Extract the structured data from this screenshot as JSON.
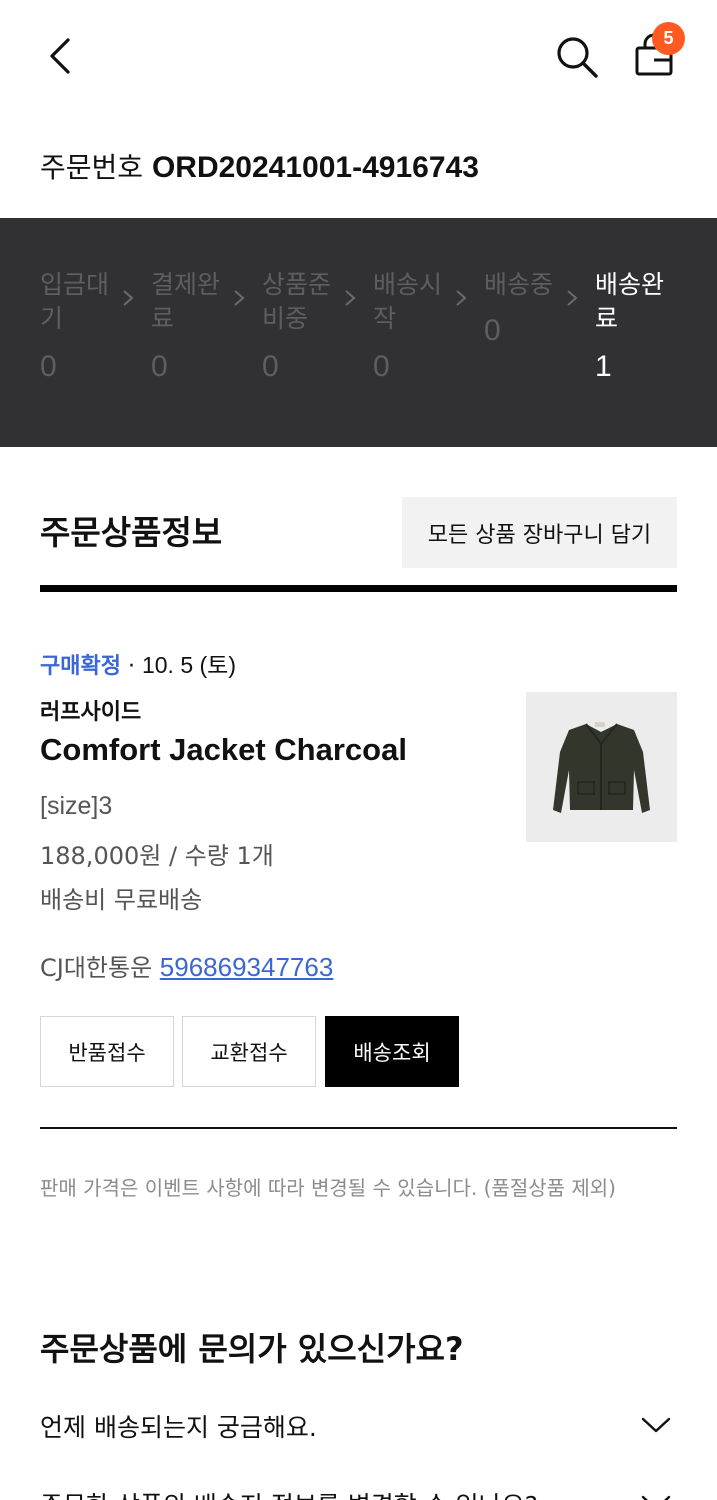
{
  "header": {
    "back_icon": "chevron-left-icon",
    "search_icon": "search-icon",
    "cart_icon": "shopping-bag-icon",
    "cart_count": "5",
    "badge_color": "#ff5a1f"
  },
  "order": {
    "label": "주문번호",
    "number": "ORD20241001-4916743"
  },
  "status_steps": [
    {
      "label": "입금대기",
      "count": "0",
      "active": false
    },
    {
      "label": "결제완료",
      "count": "0",
      "active": false
    },
    {
      "label": "상품준비중",
      "count": "0",
      "active": false
    },
    {
      "label": "배송시작",
      "count": "0",
      "active": false
    },
    {
      "label": "배송중",
      "count": "0",
      "active": false
    },
    {
      "label": "배송완료",
      "count": "1",
      "active": true
    }
  ],
  "section": {
    "title": "주문상품정보",
    "cart_all_label": "모든 상품 장바구니 담기"
  },
  "item": {
    "status": "구매확정",
    "separator": "·",
    "date": "10. 5 (토)",
    "brand": "러프사이드",
    "name": "Comfort Jacket Charcoal",
    "option": "[size]3",
    "price_qty": "188,000원 / 수량 1개",
    "shipping": "배송비 무료배송",
    "courier": "CJ대한통운",
    "tracking_no": "596869347763",
    "image": "charcoal-jacket-photo",
    "link_color": "#3b66d6"
  },
  "actions": {
    "return_label": "반품접수",
    "exchange_label": "교환접수",
    "track_label": "배송조회"
  },
  "notice": "판매 가격은 이벤트 사항에 따라 변경될 수 있습니다. (품절상품 제외)",
  "faq": {
    "title": "주문상품에 문의가 있으신가요?",
    "items": [
      "언제 배송되는지 궁금해요.",
      "주문한 상품의 배송지 정보를 변경할 수 있나요?"
    ],
    "expand_icon": "chevron-down-icon"
  }
}
